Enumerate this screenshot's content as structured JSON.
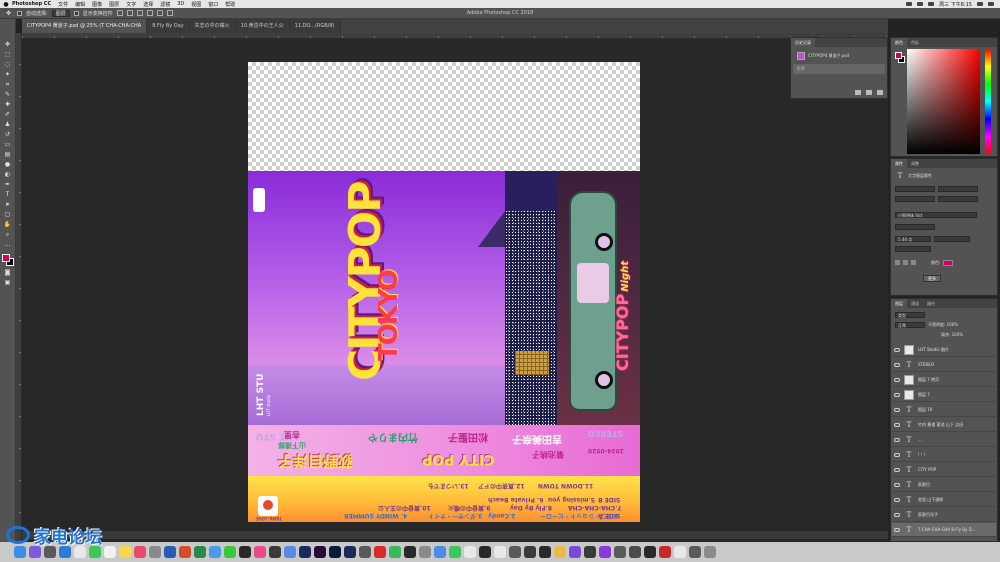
{
  "menubar": {
    "app": "Photoshop CC",
    "items": [
      "文件",
      "编辑",
      "图像",
      "图层",
      "文字",
      "选择",
      "滤镜",
      "3D",
      "视图",
      "窗口",
      "帮助"
    ],
    "clock": "周三 下午8:15"
  },
  "window_title": "Adobe Photoshop CC 2018",
  "options_bar": {
    "auto_select": "自动选择:",
    "layer_mode": "图层",
    "show_transform": "显示变换控件"
  },
  "tabs": [
    {
      "label": "CITYPOP4 黄道子.psd @ 25% (T CHA-CHA-CHA",
      "active": true
    },
    {
      "label": "8.Fly By Day",
      "active": false
    },
    {
      "label": "失恋の中の嘴火",
      "active": false
    },
    {
      "label": "10.黄昏中の王人公",
      "active": false
    },
    {
      "label": "11.DO...(RGB/8)",
      "active": false
    }
  ],
  "artwork": {
    "logo_main": "CITYPOP",
    "logo_sub": "TOKYO",
    "studio": "LHT STU",
    "studio_small": "LHT studio",
    "cp_night": "CITYPOP",
    "cp_night_script": "Night",
    "spine": {
      "lht": "LHT STU",
      "artist1": "杏里",
      "artist2": "山下達郎",
      "artist3": "荻野目洋子",
      "artist4": "竹内まりや",
      "artist5": "松田聖子",
      "artist6": "吉田美奈子",
      "artist7": "菊池桃子",
      "title": "CITY POP",
      "stereo": "STEREO",
      "catalog": "2024-0920"
    },
    "tracks": {
      "side_a": "SIDE A",
      "side_b": "SIDE B",
      "t1": "1.ラブ・ショット・ヒーロー",
      "t2": "2.Candy",
      "t3": "3.ダンサー・ナイト",
      "t4": "4. WINDY SUMMER",
      "t5": "5.missing you",
      "t6": "6. Private Beach",
      "t7": "7.CHA-CHA-CHA",
      "t8": "8.Fly By Day",
      "t9": "9.黄昏中の嘴火",
      "t10": "10.黄昏中の王人公",
      "t11": "11.DOWN TOWN",
      "t12": "12.真夜中のドア",
      "t13": "13.いつまでも",
      "label_logo": "TAMA-LOVE"
    }
  },
  "history": {
    "tab": "历史记录",
    "rows": [
      "CITYPOP4 黄道子.psd",
      "打开"
    ]
  },
  "color": {
    "tabs": [
      "颜色",
      "色板"
    ]
  },
  "properties": {
    "tabs": [
      "属性",
      "调整"
    ],
    "title": "文字图层属性",
    "font": "小冢明体 Std",
    "size": "5.44 点",
    "color_label": "颜色:",
    "button": "更多"
  },
  "layers": {
    "tabs": [
      "图层",
      "通道",
      "路径"
    ],
    "kind": "类型",
    "mode": "正常",
    "opacity": "不透明度: 100%",
    "fill": "填充: 100%",
    "rows": [
      {
        "name": "LHT Studio 图片",
        "type": "thumb"
      },
      {
        "name": "STEREO",
        "type": "text"
      },
      {
        "name": "图层 7 拷贝",
        "type": "thumb"
      },
      {
        "name": "图层 7",
        "type": "thumb"
      },
      {
        "name": "图层 10",
        "type": "text"
      },
      {
        "name": "竹内 黄道 菊池 山下 吉田",
        "type": "text"
      },
      {
        "name": "...",
        "type": "text"
      },
      {
        "name": "! ! !",
        "type": "text"
      },
      {
        "name": "CITY POP",
        "type": "text"
      },
      {
        "name": "荻野目",
        "type": "text"
      },
      {
        "name": "杏里 山下達郎",
        "type": "text"
      },
      {
        "name": "荻野目洋子",
        "type": "text"
      },
      {
        "name": "7.CHA-CHA-CHA 8.Fly By D...",
        "type": "text",
        "selected": true
      }
    ]
  },
  "watermark": "家电论坛"
}
